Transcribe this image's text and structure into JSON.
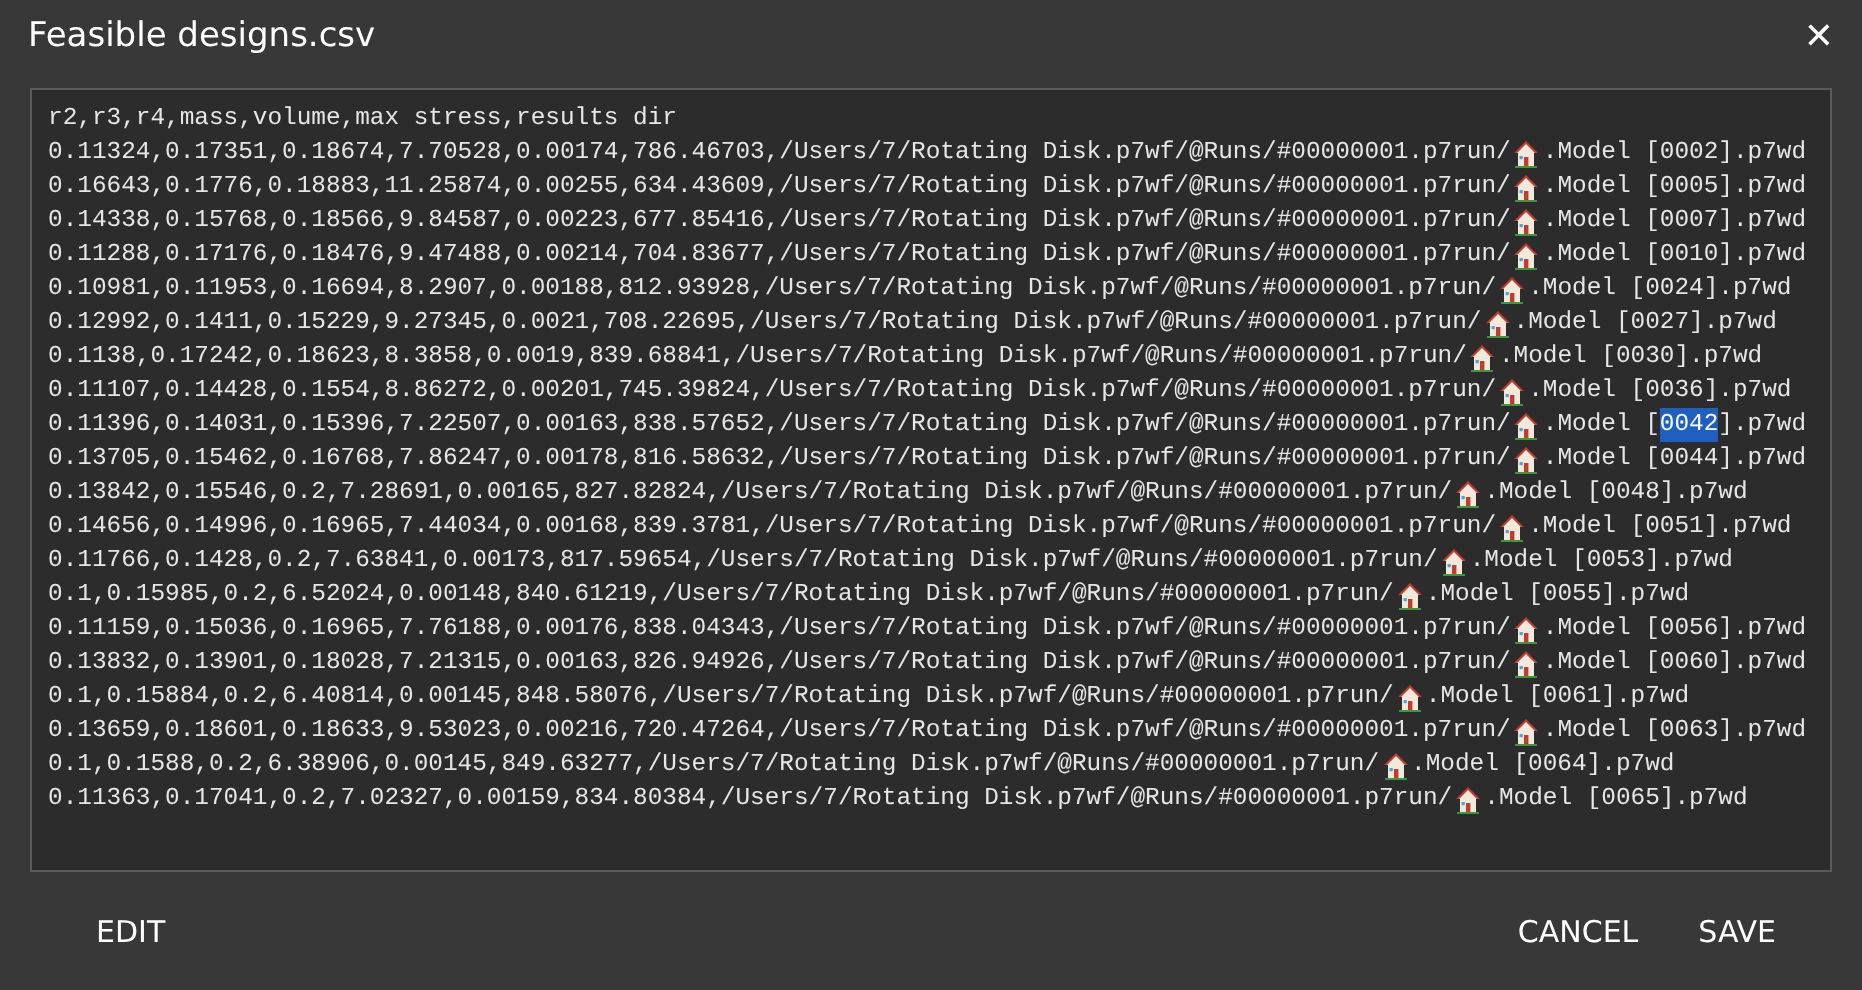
{
  "dialog": {
    "title": "Feasible designs.csv",
    "close": "✕"
  },
  "csv": {
    "header": "r2,r3,r4,mass,volume,max stress,results dir",
    "rows": [
      {
        "path": "0.11324,0.17351,0.18674,7.70528,0.00174,786.46703,/Users/7/Rotating Disk.p7wf/@Runs/#00000001.p7run/",
        "file": [
          {
            "text": ".Model [0002].p7wd",
            "selected": false
          }
        ]
      },
      {
        "path": "0.16643,0.1776,0.18883,11.25874,0.00255,634.43609,/Users/7/Rotating Disk.p7wf/@Runs/#00000001.p7run/",
        "file": [
          {
            "text": ".Model [0005].p7wd",
            "selected": false
          }
        ]
      },
      {
        "path": "0.14338,0.15768,0.18566,9.84587,0.00223,677.85416,/Users/7/Rotating Disk.p7wf/@Runs/#00000001.p7run/",
        "file": [
          {
            "text": ".Model [0007].p7wd",
            "selected": false
          }
        ]
      },
      {
        "path": "0.11288,0.17176,0.18476,9.47488,0.00214,704.83677,/Users/7/Rotating Disk.p7wf/@Runs/#00000001.p7run/",
        "file": [
          {
            "text": ".Model [0010].p7wd",
            "selected": false
          }
        ]
      },
      {
        "path": "0.10981,0.11953,0.16694,8.2907,0.00188,812.93928,/Users/7/Rotating Disk.p7wf/@Runs/#00000001.p7run/",
        "file": [
          {
            "text": ".Model [0024].p7wd",
            "selected": false
          }
        ]
      },
      {
        "path": "0.12992,0.1411,0.15229,9.27345,0.0021,708.22695,/Users/7/Rotating Disk.p7wf/@Runs/#00000001.p7run/",
        "file": [
          {
            "text": ".Model [0027].p7wd",
            "selected": false
          }
        ]
      },
      {
        "path": "0.1138,0.17242,0.18623,8.3858,0.0019,839.68841,/Users/7/Rotating Disk.p7wf/@Runs/#00000001.p7run/",
        "file": [
          {
            "text": ".Model [0030].p7wd",
            "selected": false
          }
        ]
      },
      {
        "path": "0.11107,0.14428,0.1554,8.86272,0.00201,745.39824,/Users/7/Rotating Disk.p7wf/@Runs/#00000001.p7run/",
        "file": [
          {
            "text": ".Model [0036].p7wd",
            "selected": false
          }
        ]
      },
      {
        "path": "0.11396,0.14031,0.15396,7.22507,0.00163,838.57652,/Users/7/Rotating Disk.p7wf/@Runs/#00000001.p7run/",
        "file": [
          {
            "text": ".Model [",
            "selected": false
          },
          {
            "text": "0042",
            "selected": true
          },
          {
            "text": "].p7wd",
            "selected": false
          }
        ]
      },
      {
        "path": "0.13705,0.15462,0.16768,7.86247,0.00178,816.58632,/Users/7/Rotating Disk.p7wf/@Runs/#00000001.p7run/",
        "file": [
          {
            "text": ".Model [0044].p7wd",
            "selected": false
          }
        ]
      },
      {
        "path": "0.13842,0.15546,0.2,7.28691,0.00165,827.82824,/Users/7/Rotating Disk.p7wf/@Runs/#00000001.p7run/",
        "file": [
          {
            "text": ".Model [0048].p7wd",
            "selected": false
          }
        ]
      },
      {
        "path": "0.14656,0.14996,0.16965,7.44034,0.00168,839.3781,/Users/7/Rotating Disk.p7wf/@Runs/#00000001.p7run/",
        "file": [
          {
            "text": ".Model [0051].p7wd",
            "selected": false
          }
        ]
      },
      {
        "path": "0.11766,0.1428,0.2,7.63841,0.00173,817.59654,/Users/7/Rotating Disk.p7wf/@Runs/#00000001.p7run/",
        "file": [
          {
            "text": ".Model [0053].p7wd",
            "selected": false
          }
        ]
      },
      {
        "path": "0.1,0.15985,0.2,6.52024,0.00148,840.61219,/Users/7/Rotating Disk.p7wf/@Runs/#00000001.p7run/",
        "file": [
          {
            "text": ".Model [0055].p7wd",
            "selected": false
          }
        ]
      },
      {
        "path": "0.11159,0.15036,0.16965,7.76188,0.00176,838.04343,/Users/7/Rotating Disk.p7wf/@Runs/#00000001.p7run/",
        "file": [
          {
            "text": ".Model [0056].p7wd",
            "selected": false
          }
        ]
      },
      {
        "path": "0.13832,0.13901,0.18028,7.21315,0.00163,826.94926,/Users/7/Rotating Disk.p7wf/@Runs/#00000001.p7run/",
        "file": [
          {
            "text": ".Model [0060].p7wd",
            "selected": false
          }
        ]
      },
      {
        "path": "0.1,0.15884,0.2,6.40814,0.00145,848.58076,/Users/7/Rotating Disk.p7wf/@Runs/#00000001.p7run/",
        "file": [
          {
            "text": ".Model [0061].p7wd",
            "selected": false
          }
        ]
      },
      {
        "path": "0.13659,0.18601,0.18633,9.53023,0.00216,720.47264,/Users/7/Rotating Disk.p7wf/@Runs/#00000001.p7run/",
        "file": [
          {
            "text": ".Model [0063].p7wd",
            "selected": false
          }
        ]
      },
      {
        "path": "0.1,0.1588,0.2,6.38906,0.00145,849.63277,/Users/7/Rotating Disk.p7wf/@Runs/#00000001.p7run/",
        "file": [
          {
            "text": ".Model [0064].p7wd",
            "selected": false
          }
        ]
      },
      {
        "path": "0.11363,0.17041,0.2,7.02327,0.00159,834.80384,/Users/7/Rotating Disk.p7wf/@Runs/#00000001.p7run/",
        "file": [
          {
            "text": ".Model [0065].p7wd",
            "selected": false
          }
        ]
      }
    ]
  },
  "buttons": [
    {
      "label": "EDIT",
      "kind": "left"
    },
    {
      "label": "CANCEL",
      "kind": "right"
    },
    {
      "label": "SAVE",
      "kind": "right"
    }
  ]
}
